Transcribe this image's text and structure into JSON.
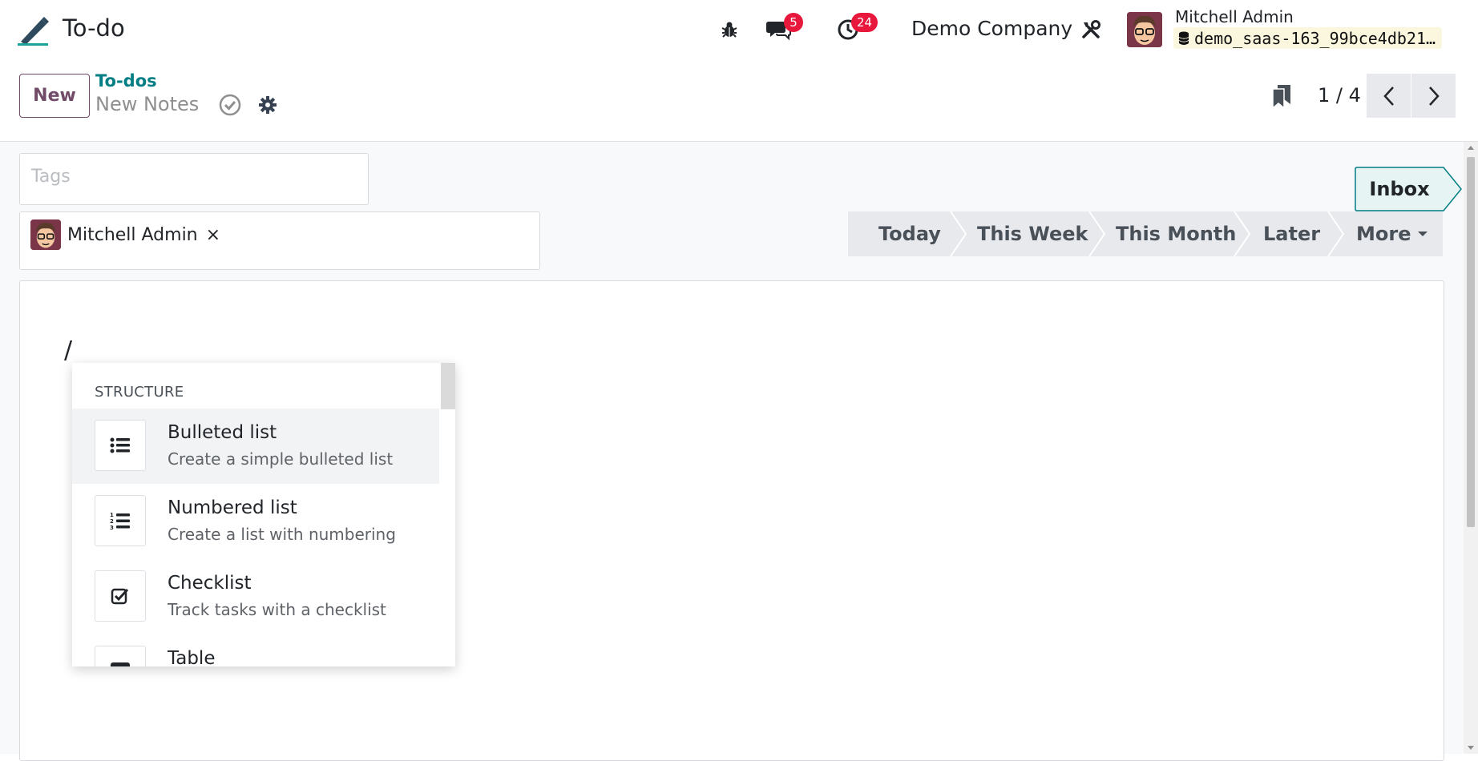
{
  "navbar": {
    "app_title": "To-do",
    "messages_badge": "5",
    "activities_badge": "24",
    "company": "Demo Company",
    "user_name": "Mitchell Admin",
    "database": "demo_saas-163_99bce4db21…"
  },
  "control_panel": {
    "new_label": "New",
    "breadcrumb_parent": "To-dos",
    "breadcrumb_current": "New Notes",
    "pager_value": "1 / 4"
  },
  "form": {
    "tags_placeholder": "Tags",
    "assignee_name": "Mitchell Admin",
    "assignee_remove": "×",
    "inbox_label": "Inbox",
    "stages": [
      "Today",
      "This Week",
      "This Month",
      "Later",
      "More"
    ],
    "editor_text": "/"
  },
  "powerbox": {
    "category": "STRUCTURE",
    "items": [
      {
        "title": "Bulleted list",
        "description": "Create a simple bulleted list",
        "icon": "list-ul-icon"
      },
      {
        "title": "Numbered list",
        "description": "Create a list with numbering",
        "icon": "list-ol-icon"
      },
      {
        "title": "Checklist",
        "description": "Track tasks with a checklist",
        "icon": "check-square-icon"
      },
      {
        "title": "Table",
        "description": "",
        "icon": "table-icon"
      }
    ]
  },
  "colors": {
    "brand": "#714b67",
    "link": "#017e84",
    "badge": "#e8173c",
    "inbox_bg": "#e6f4f4"
  }
}
